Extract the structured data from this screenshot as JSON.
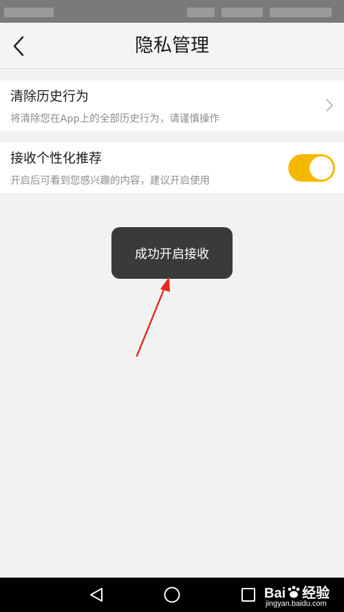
{
  "header": {
    "title": "隐私管理",
    "back_icon": "chevron-left-icon"
  },
  "settings": [
    {
      "title": "清除历史行为",
      "subtitle": "将清除您在App上的全部历史行为，请谨慎操作",
      "control": "chevron-right-icon"
    },
    {
      "title": "接收个性化推荐",
      "subtitle": "开启后可看到您感兴趣的内容，建议开启使用",
      "control": "toggle",
      "toggle_on": true
    }
  ],
  "toast": {
    "text": "成功开启接收"
  },
  "colors": {
    "accent": "#f5b800",
    "background": "#f2f2f2",
    "toast_bg": "#3a3a3a",
    "annotation_arrow": "#e8281e"
  },
  "nav_bar": {
    "buttons": [
      "back-triangle-icon",
      "home-circle-icon",
      "recents-square-icon"
    ]
  },
  "watermark": {
    "brand": "Bai",
    "brand_suffix": "经验",
    "url": "jingyan.baidu.com"
  }
}
